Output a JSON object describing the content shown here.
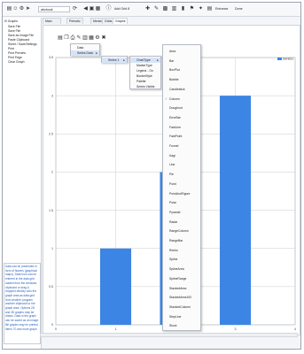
{
  "toolbar": {
    "path_value": "abcbook",
    "sheet_label": "Add Grid 8",
    "right_labels": [
      "Entrance",
      "Done"
    ]
  },
  "tree": {
    "root": "Graphs",
    "items": [
      "Save File",
      "Save File",
      "Save as Image File",
      "Paste Clipboard",
      "Sheet / Save/Settings",
      "Print",
      "Print Preview",
      "Print Page",
      "Clear Graph"
    ]
  },
  "note_text": "Data can be presented in form of flowers (graphical maps). Data from can be entered in the data grid loaded from the windows clipboard or drag & dropped directly onto the graph area as data grid from another program another clipboard or the graph area. Options 2D and 3D graphs may be drawn. Data in the graph can be saved as an image file graphs may be printed. Items 70 and more graph",
  "tabs": [
    "Main Functions",
    "Periodic Table",
    "Media",
    "Grids",
    "Graphs"
  ],
  "active_tab_index": 4,
  "menus": {
    "m1": [
      "Data",
      "Series Data"
    ],
    "m2": [
      "Series 1"
    ],
    "m3": [
      "ChartType",
      "MarkerType",
      "Legend - On",
      "BorderStyle",
      "Palette",
      "Series Visible"
    ],
    "m4": [
      "Area",
      "Bar",
      "BoxPlot",
      "Bubble",
      "Candlestick",
      "Column",
      "Doughnut",
      "ErrorBar",
      "FastLine",
      "FastPoint",
      "Funnel",
      "Kagi",
      "Line",
      "Pie",
      "Point",
      "PointAndFigure",
      "Polar",
      "Pyramid",
      "Radar",
      "RangeColumn",
      "RangeBar",
      "Renko",
      "Spline",
      "SplineArea",
      "SplineRange",
      "StackedArea",
      "StackedArea100",
      "StackedColumn",
      "StepLine",
      "Stock"
    ],
    "m4_checked": "Column"
  },
  "chart_data": {
    "type": "bar",
    "categories": [
      "1",
      "2",
      "3"
    ],
    "series": [
      {
        "name": "Series1",
        "values": [
          1,
          2,
          3
        ],
        "color": "#3d85e4"
      }
    ],
    "ylim": [
      0,
      3.5
    ],
    "yticks": [
      "0",
      "0.5",
      "1",
      "1.5",
      "2",
      "2.5",
      "3",
      "3.5"
    ],
    "xticks": [
      "0",
      "1",
      "2",
      "3",
      "4"
    ],
    "grid": true,
    "legend_position": "top-right"
  }
}
